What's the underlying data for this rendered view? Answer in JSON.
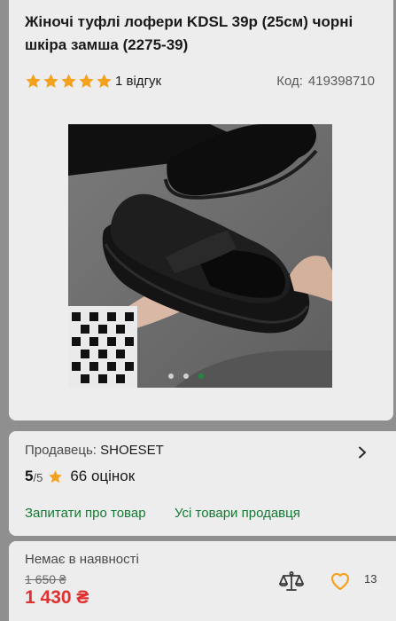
{
  "product": {
    "title": "Жіночі туфлі лофери KDSL 39р (25см) чорні шкіра замша (2275-39)",
    "rating_stars": 5,
    "reviews_label": "1 відгук",
    "code_label": "Код:",
    "code_value": "419398710"
  },
  "gallery": {
    "image_count": 3,
    "active_index": 2
  },
  "seller": {
    "label": "Продавець:",
    "name": "SHOESET",
    "rating_value": "5",
    "rating_max": "/5",
    "ratings_count": "66 оцінок",
    "ask_link": "Запитати про товар",
    "all_products_link": "Усі товари продавця"
  },
  "purchase": {
    "stock_status": "Немає в наявності",
    "old_price": "1 650 ₴",
    "price": "1 430 ₴",
    "favorites_count": "13"
  },
  "colors": {
    "star": "#f4a11d",
    "link": "#127a32",
    "price": "#e03030",
    "heart": "#f4a11d"
  }
}
